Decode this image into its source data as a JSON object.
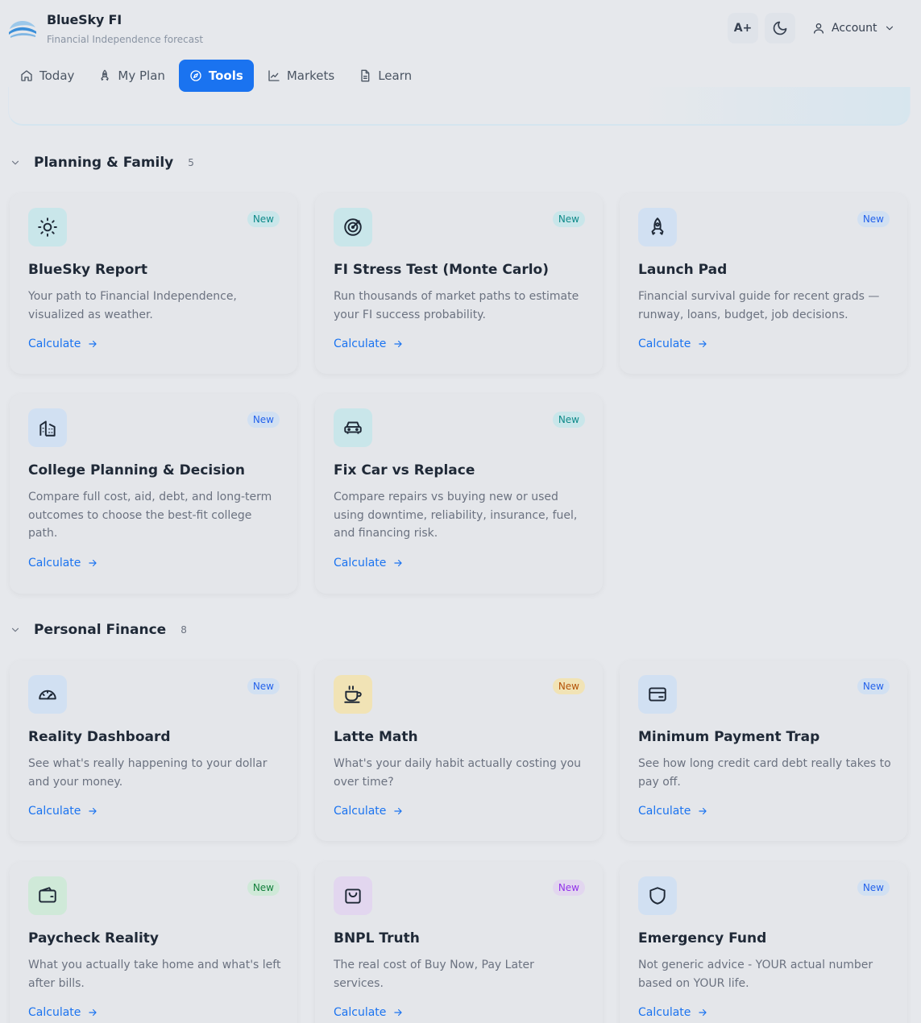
{
  "header": {
    "title": "BlueSky FI",
    "subtitle": "Financial Independence forecast",
    "font_size_label": "A+",
    "account_label": "Account"
  },
  "nav": [
    {
      "label": "Today",
      "icon": "home-icon"
    },
    {
      "label": "My Plan",
      "icon": "rocket-icon"
    },
    {
      "label": "Tools",
      "icon": "compass-icon",
      "active": true
    },
    {
      "label": "Markets",
      "icon": "chart-line-icon"
    },
    {
      "label": "Learn",
      "icon": "document-icon"
    }
  ],
  "sections": [
    {
      "title": "Planning & Family",
      "count": "5",
      "cards": [
        {
          "title": "BlueSky Report",
          "desc": "Your path to Financial Independence, visualized as weather.",
          "badge": "New",
          "link": "Calculate",
          "icon": "sun-icon"
        },
        {
          "title": "FI Stress Test (Monte Carlo)",
          "desc": "Run thousands of market paths to estimate your FI success probability.",
          "badge": "New",
          "link": "Calculate",
          "icon": "target-icon"
        },
        {
          "title": "Launch Pad",
          "desc": "Financial survival guide for recent grads — runway, loans, budget, job decisions.",
          "badge": "New",
          "link": "Calculate",
          "icon": "rocket-icon"
        },
        {
          "title": "College Planning & Decision",
          "desc": "Compare full cost, aid, debt, and long-term outcomes to choose the best-fit college path.",
          "badge": "New",
          "link": "Calculate",
          "icon": "building-icon"
        },
        {
          "title": "Fix Car vs Replace",
          "desc": "Compare repairs vs buying new or used using downtime, reliability, insurance, fuel, and financing risk.",
          "badge": "New",
          "link": "Calculate",
          "icon": "car-icon"
        }
      ]
    },
    {
      "title": "Personal Finance",
      "count": "8",
      "cards": [
        {
          "title": "Reality Dashboard",
          "desc": "See what's really happening to your dollar and your money.",
          "badge": "New",
          "link": "Calculate",
          "icon": "gauge-icon"
        },
        {
          "title": "Latte Math",
          "desc": "What's your daily habit actually costing you over time?",
          "badge": "New",
          "link": "Calculate",
          "icon": "coffee-icon"
        },
        {
          "title": "Minimum Payment Trap",
          "desc": "See how long credit card debt really takes to pay off.",
          "badge": "New",
          "link": "Calculate",
          "icon": "credit-card-icon"
        },
        {
          "title": "Paycheck Reality",
          "desc": "What you actually take home and what's left after bills.",
          "badge": "New",
          "link": "Calculate",
          "icon": "wallet-icon"
        },
        {
          "title": "BNPL Truth",
          "desc": "The real cost of Buy Now, Pay Later services.",
          "badge": "New",
          "link": "Calculate",
          "icon": "shopping-bag-icon"
        },
        {
          "title": "Emergency Fund",
          "desc": "Not generic advice - YOUR actual number based on YOUR life.",
          "badge": "New",
          "link": "Calculate",
          "icon": "shield-icon"
        }
      ]
    }
  ],
  "colors": {
    "accent": "#1a73f0",
    "background": "#e6e8ec",
    "icon_teal_bg": "#c9e6ea",
    "icon_blue_bg": "#d1e0f2",
    "icon_yellow_bg": "#f1e3b5",
    "icon_green_bg": "#cfe9d8",
    "icon_purple_bg": "#e2d6ef"
  }
}
